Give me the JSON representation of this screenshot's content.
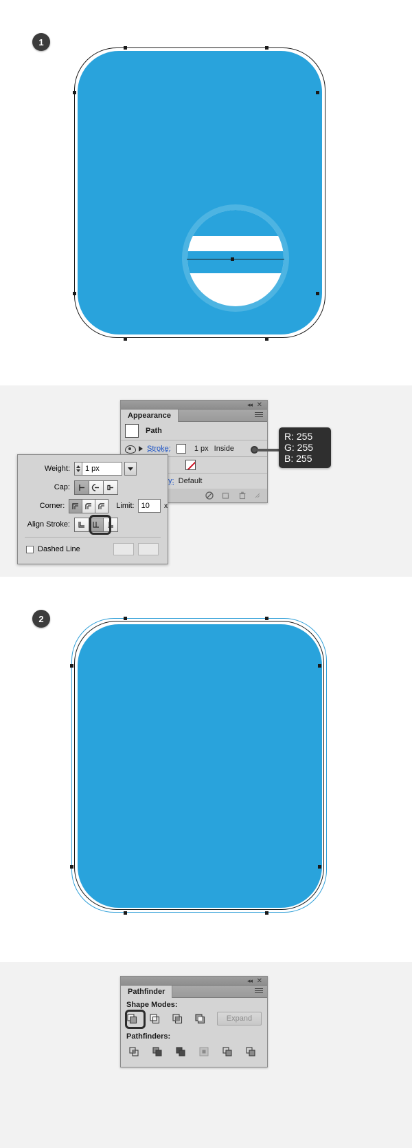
{
  "steps": [
    {
      "number": "1"
    },
    {
      "number": "2"
    }
  ],
  "callout": {
    "r": "R: 255",
    "g": "G: 255",
    "b": "B: 255"
  },
  "appearance_panel": {
    "tab_label": "Appearance",
    "collapse_icon": "collapse-icon",
    "close_icon": "close-icon",
    "menu_icon": "panel-menu-icon",
    "rows": [
      {
        "type": "path",
        "label": "Path"
      },
      {
        "type": "stroke",
        "label": "Stroke:",
        "weight": "1 px",
        "align": "Inside"
      },
      {
        "type": "fill",
        "label": ""
      },
      {
        "type": "opacity",
        "label": "ty:",
        "value": "Default"
      }
    ],
    "footer_icons": [
      "no-appearance-icon",
      "duplicate-item-icon",
      "delete-item-icon",
      "resize-grip-icon"
    ]
  },
  "stroke_dialog": {
    "weight_label": "Weight:",
    "weight_value": "1 px",
    "cap_label": "Cap:",
    "corner_label": "Corner:",
    "limit_label": "Limit:",
    "limit_value": "10",
    "limit_unit": "x",
    "align_stroke_label": "Align Stroke:",
    "dashed_line_label": "Dashed Line",
    "cap_options": [
      "butt-cap-icon",
      "round-cap-icon",
      "projecting-cap-icon"
    ],
    "cap_selected": 0,
    "corner_options": [
      "miter-join-icon",
      "round-join-icon",
      "bevel-join-icon"
    ],
    "corner_selected": 0,
    "align_options": [
      "align-center-icon",
      "align-inside-icon",
      "align-outside-icon"
    ],
    "align_selected": 1
  },
  "pathfinder_panel": {
    "tab_label": "Pathfinder",
    "shape_modes_label": "Shape Modes:",
    "pathfinders_label": "Pathfinders:",
    "expand_label": "Expand",
    "collapse_icon": "collapse-icon",
    "close_icon": "close-icon",
    "menu_icon": "panel-menu-icon",
    "shape_modes": [
      "unite-icon",
      "minus-front-icon",
      "intersect-icon",
      "exclude-icon"
    ],
    "shape_mode_selected": 0,
    "pathfinders": [
      "divide-icon",
      "trim-icon",
      "merge-icon",
      "crop-icon",
      "outline-icon",
      "minus-back-icon"
    ]
  },
  "colors": {
    "artwork_blue": "#29a3dc",
    "artwork_blue_light": "#4db4e2",
    "panel_bg": "#d4d4d4",
    "band_grey": "#f2f2f2",
    "callout_bg": "#2f2f2f",
    "link_blue": "#1b52c4"
  }
}
